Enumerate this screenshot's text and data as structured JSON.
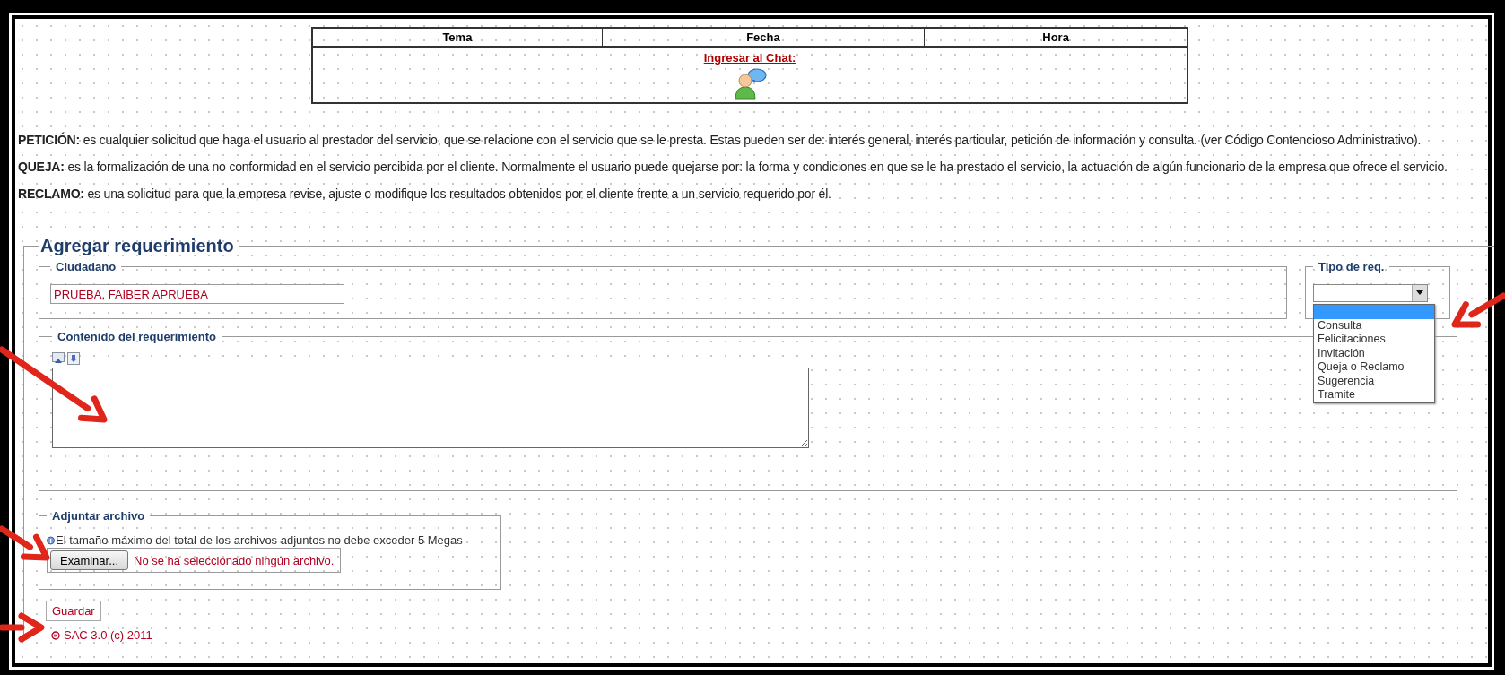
{
  "schedule_table": {
    "columns": [
      "Tema",
      "Fecha",
      "Hora"
    ],
    "chat_link": "Ingresar al Chat:"
  },
  "definitions": [
    {
      "text": "**PETICIÓN:** es cualquier solicitud que haga el usuario al prestador del servicio, que se relacione con el servicio que se le presta. Estas pueden ser de: interés general, interés particular, petición de información y consulta. (ver Código Contencioso Administrativo)."
    },
    {
      "text": "**QUEJA:** es la formalización de una no conformidad en el servicio percibida por el cliente. Normalmente el usuario puede quejarse por: la forma y condiciones en que se le ha prestado el servicio, la actuación de algún funcionario de la empresa que ofrece el servicio."
    },
    {
      "text": "**RECLAMO:** es una solicitud para que la empresa revise, ajuste o modifique los resultados obtenidos por el cliente frente a un servicio requerido por él."
    }
  ],
  "form": {
    "title": "Agregar requerimiento",
    "citizen": {
      "legend": "Ciudadano",
      "value": "PRUEBA, FAIBER APRUEBA"
    },
    "request_type": {
      "legend": "Tipo de req.",
      "expanded": true,
      "options": [
        {
          "selected": true
        },
        {
          "label": "Consulta",
          "selected": false
        },
        {
          "label": "Felicitaciones",
          "selected": false
        },
        {
          "label": "Invitación",
          "selected": false
        },
        {
          "label": "Queja o Reclamo",
          "selected": false
        },
        {
          "label": "Sugerencia",
          "selected": false
        },
        {
          "label": "Tramite",
          "selected": false
        }
      ]
    },
    "content": {
      "legend": "Contenido del requerimiento"
    },
    "attachment": {
      "legend": "Adjuntar archivo",
      "note": "El tamaño máximo del total de los archivos adjuntos no debe exceder 5 Megas",
      "browse_button": "Examinar...",
      "file_status": "No se ha seleccionado ningún archivo."
    },
    "save_button": "Guardar",
    "footer": "SAC 3.0 (c) 2011"
  }
}
